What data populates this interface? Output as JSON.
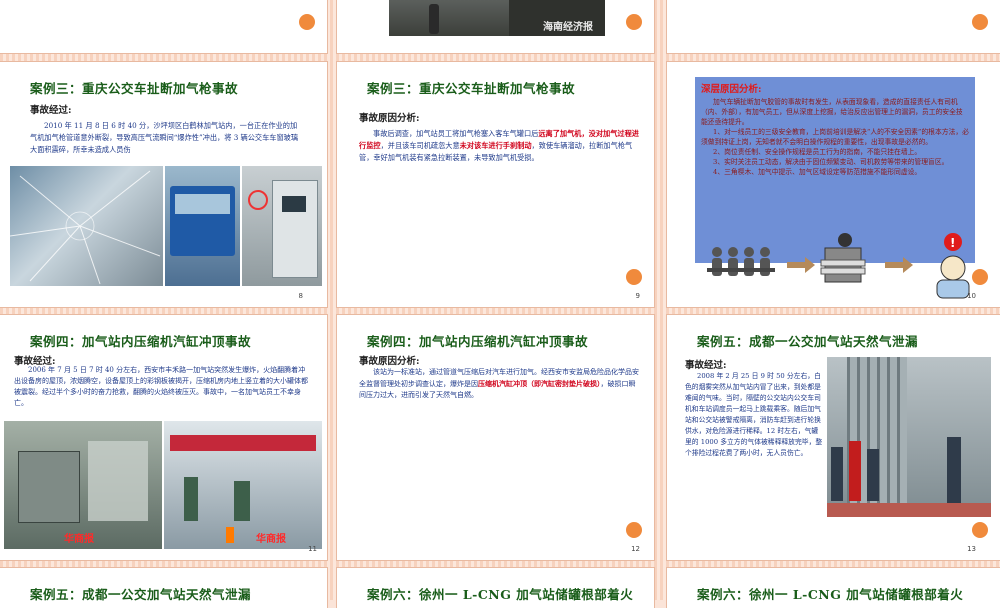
{
  "top_slide": {
    "watermark": "海南经济报"
  },
  "slide8": {
    "title": "案例三：重庆公交车扯断加气枪事故",
    "subtitle": "事故经过:",
    "body": "2010 年 11 月 8 日 6 时 40 分，沙坪坝区白鹤林加气站内，一台正在作业的加气机加气枪管道意外断裂，导致高压气流瞬间“爆炸性”冲出，将 3 辆公交车车窗玻璃大面积震碎，所幸未造成人员伤",
    "page": "8"
  },
  "slide9": {
    "title": "案例三：重庆公交车扯断加气枪事故",
    "subtitle": "事故原因分析:",
    "body_a": "事故后调查，加气站员工将加气枪塞入客车气罐口后",
    "body_red1": "远离了加气机，没对加气过程进行监控",
    "body_b": "，并且该车司机疏忽大意",
    "body_red2": "未对该车进行手刹制动",
    "body_c": "，致使车辆溜动，拉断加气枪气管，幸好加气机装有紧急拉断装置，未导致加气机受损。",
    "page": "9"
  },
  "slide10": {
    "heading": "深层原因分析:",
    "p1": "加气车辆扯断加气胶管的事故时有发生，从表面现象看，造成的直接责任人有司机（内、外部），有加气员工，但从深度上挖掘，给治反应出管理上的漏洞，员工的安全技能还亟待提升。",
    "p2": "1、对一线员工的三级安全教育，上岗前培训是解决“人的不安全因素”的根本方法，必须做到持证上岗，无知者就不会明白操作规程的重要性，出现事故是必然的。",
    "p3": "2、岗位责任制、安全操作规程是员工行为的指南，不能只挂在墙上。",
    "p4": "3、实时关注员工动态，解决由于固位频繁变动、司机救劳等带来的管理盲区。",
    "p5": "4、三角楔木、加气中提示、加气区域设定等防范措施不能形同虚设。",
    "page": "10"
  },
  "slide11": {
    "title": "案例四：加气站内压缩机汽缸冲顶事故",
    "subtitle": "事故经过:",
    "body": "2006 年 7 月 5 日 7 时 40 分左右，西安市丰禾路一加气站突然发生爆炸，火焰翻腾着冲出设备房的屋顶，浓烟腾空，设备屋顶上的彩钢板被揭开，压缩机房内地上竖立着的大小罐体都被震裂。经过半个多小时的奋力抢救，翻腾的火焰终被压灭。事故中，一名加气站员工不幸身亡。",
    "watermark1": "华商报",
    "watermark2": "华商报",
    "page": "11"
  },
  "slide12": {
    "title": "案例四：加气站内压缩机汽缸冲顶事故",
    "subtitle": "事故原因分析:",
    "body_a": "该站为一标准站，通过管道气压缩后对汽车进行加气。经西安市安监局危险品化学品安全监督管理处初步调查认定，爆炸是因",
    "body_red": "压缩机汽缸冲顶（即汽缸密封垫片破损）",
    "body_b": "，破损口瞬间压力过大，进而引发了天然气自燃。",
    "page": "12"
  },
  "slide13": {
    "title": "案例五：成都一公交加气站天然气泄漏",
    "subtitle": "事故经过:",
    "body": "2008 年 2 月 25 日 9 时 50 分左右，白色的烟雾突然从加气站内冒了出来，到处都是难闻的气味。当时，隔壁的公交站内公交车司机和车站调度员一起马上跳载乘客。随后加气站和公交站被警戒隔离，消防车赶到进行轮换供水，对危险源进行稀释。12 时左右，气罐里的 1000 多立方的气体被稀释释放完毕，整个排险过程花费了两小时，无人员伤亡。",
    "page": "13"
  },
  "slide14": {
    "title": "案例五：成都一公交加气站天然气泄漏"
  },
  "slide15": {
    "title": "案例六：徐州一 L-CNG 加气站储罐根部着火"
  },
  "slide16": {
    "title": "案例六：徐州一 L-CNG 加气站储罐根部着火"
  }
}
